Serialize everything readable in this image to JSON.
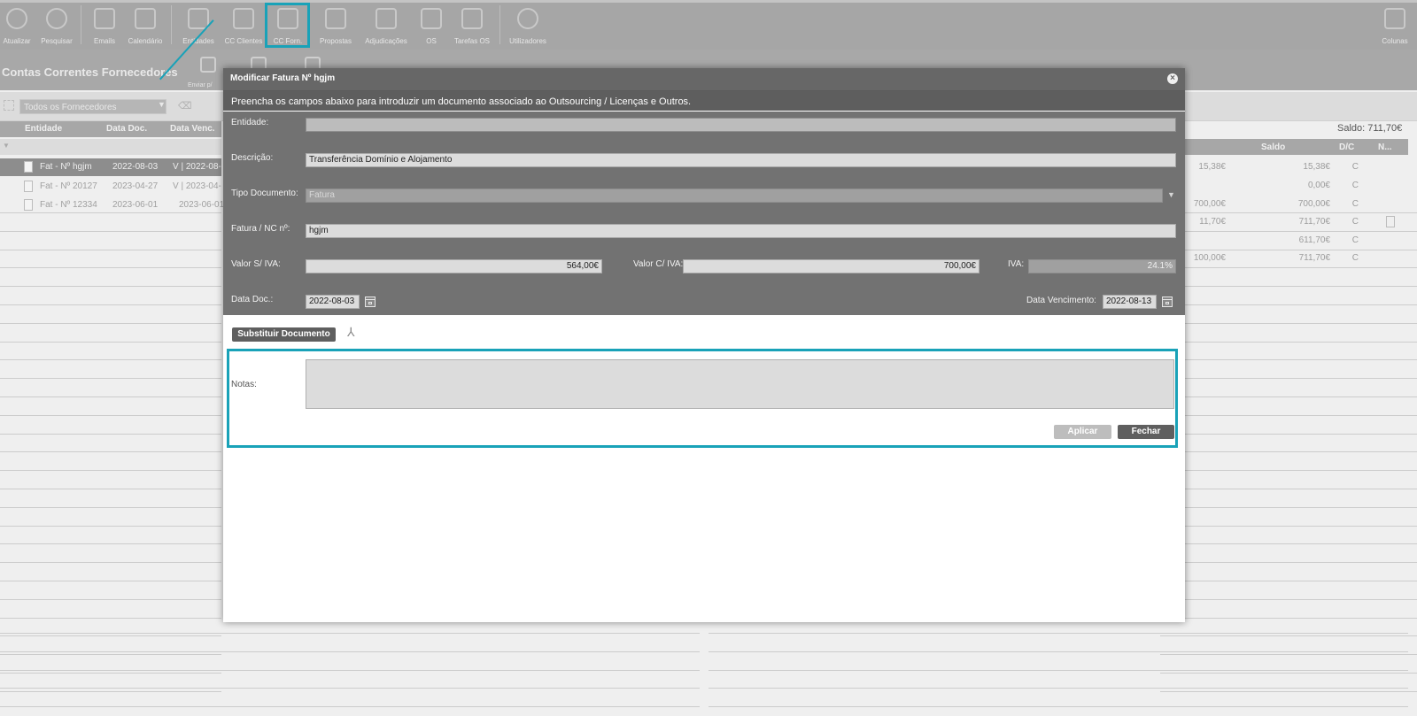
{
  "toolbar": {
    "items": [
      {
        "label": "Atualizar",
        "icon": "refresh-icon"
      },
      {
        "label": "Pesquisar",
        "icon": "search-icon"
      },
      {
        "label": "Emails",
        "icon": "email-icon"
      },
      {
        "label": "Calendário",
        "icon": "calendar-icon"
      },
      {
        "label": "Entidades",
        "icon": "entities-icon"
      },
      {
        "label": "CC Clientes",
        "icon": "clients-icon"
      },
      {
        "label": "CC Forn.",
        "icon": "suppliers-icon"
      },
      {
        "label": "Propostas",
        "icon": "proposals-icon"
      },
      {
        "label": "Adjudicações",
        "icon": "check-icon"
      },
      {
        "label": "OS",
        "icon": "wrench-icon"
      },
      {
        "label": "Tarefas OS",
        "icon": "tools-icon"
      },
      {
        "label": "Utilizadores",
        "icon": "users-icon"
      },
      {
        "label": "Colunas",
        "icon": "columns-icon"
      }
    ]
  },
  "subbar": {
    "title": "Contas Correntes Fornecedores",
    "send_label": "Enviar p/"
  },
  "filter": {
    "selected": "Todos os Fornecedores"
  },
  "saldo_total": "Saldo: 711,70€",
  "grid": {
    "columns": [
      "Entidade",
      "Data Doc.",
      "Data Venc."
    ],
    "right_columns": [
      "Saldo",
      "D/C",
      "N..."
    ],
    "left_rows": [
      {
        "doc": "Fat - Nº hgjm",
        "date": "2022-08-03",
        "venc": "V | 2022-08-"
      },
      {
        "doc": "Fat - Nº 20127",
        "date": "2023-04-27",
        "venc": "V | 2023-04-"
      },
      {
        "doc": "Fat - Nº 12334",
        "date": "2023-06-01",
        "venc": "2023-06-01"
      }
    ],
    "right_rows": [
      {
        "a": "15,38€",
        "saldo": "15,38€",
        "dc": "C"
      },
      {
        "a": "",
        "saldo": "0,00€",
        "dc": "C"
      },
      {
        "a": "700,00€",
        "saldo": "700,00€",
        "dc": "C"
      },
      {
        "a": "11,70€",
        "saldo": "711,70€",
        "dc": "C"
      },
      {
        "a": "",
        "saldo": "611,70€",
        "dc": "C"
      },
      {
        "a": "100,00€",
        "saldo": "711,70€",
        "dc": "C"
      }
    ]
  },
  "modal": {
    "title": "Modificar Fatura Nº hgjm",
    "close": "×",
    "info": "Preencha os campos abaixo para introduzir um documento associado ao Outsourcing / Licenças e Outros.",
    "labels": {
      "entidade": "Entidade:",
      "descricao": "Descrição:",
      "tipo": "Tipo Documento:",
      "fatura": "Fatura / NC nº:",
      "valor_sem": "Valor S/ IVA:",
      "valor_com": "Valor C/ IVA:",
      "iva": "IVA:",
      "data_doc": "Data Doc.:",
      "data_venc": "Data Vencimento:",
      "notas": "Notas:"
    },
    "values": {
      "entidade": "",
      "descricao": "Transferência Domínio e  Alojamento",
      "tipo": "Fatura",
      "fatura": "hgjm",
      "valor_sem": "564,00€",
      "valor_com": "700,00€",
      "iva": "24.1%",
      "data_doc": "2022-08-03",
      "data_venc": "2022-08-13",
      "notas": ""
    },
    "buttons": {
      "substituir": "Substituir Documento",
      "aplicar": "Aplicar",
      "fechar": "Fechar"
    }
  }
}
